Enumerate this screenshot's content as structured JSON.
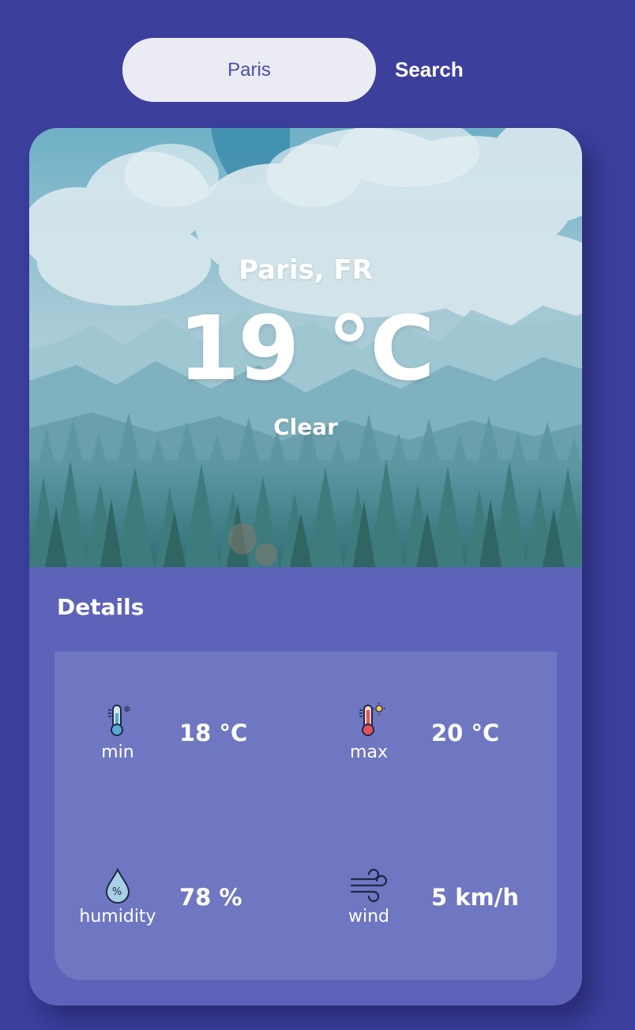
{
  "search": {
    "value": "Paris",
    "button_label": "Search"
  },
  "weather": {
    "location": "Paris, FR",
    "temperature": "19 °C",
    "condition": "Clear"
  },
  "details": {
    "title": "Details",
    "min": {
      "label": "min",
      "value": "18 °C",
      "icon": "thermometer-cold-icon"
    },
    "max": {
      "label": "max",
      "value": "20 °C",
      "icon": "thermometer-hot-icon"
    },
    "humidity": {
      "label": "humidity",
      "value": "78 %",
      "icon": "humidity-drop-icon"
    },
    "wind": {
      "label": "wind",
      "value": "5 km/h",
      "icon": "wind-icon"
    }
  },
  "colors": {
    "page_background": "#3c3f9c",
    "card_background": "#5c63b9",
    "panel_background": "#6f77c2",
    "search_text": "#4d50a8"
  }
}
